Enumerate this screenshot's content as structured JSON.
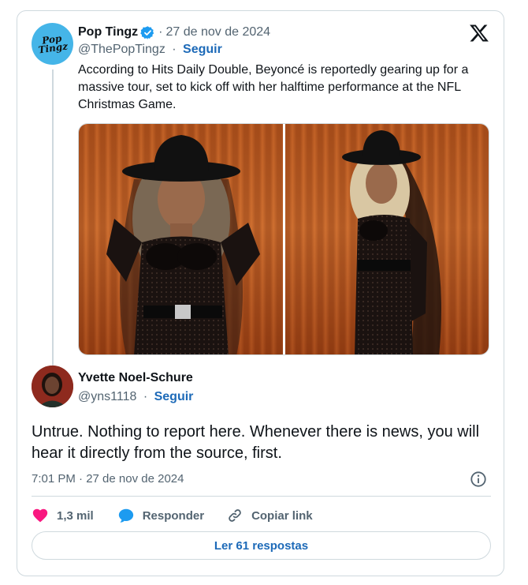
{
  "parent_tweet": {
    "avatar_text": "Pop Tingz",
    "name": "Pop Tingz",
    "separator": "·",
    "date": "27 de nov de 2024",
    "handle": "@ThePopTingz",
    "follow_label": "Seguir",
    "text": "According to Hits Daily Double, Beyoncé is reportedly gearing up for a massive tour, set to kick off with her halftime performance at the NFL Christmas Game.",
    "media_count": 2
  },
  "reply_tweet": {
    "name": "Yvette Noel-Schure",
    "handle": "@yns1118",
    "separator": "·",
    "follow_label": "Seguir",
    "text": "Untrue.  Nothing to report here.  Whenever there is news, you will hear it directly from the source, first.",
    "timestamp": "7:01 PM · 27 de nov de 2024"
  },
  "actions": {
    "like_count": "1,3 mil",
    "reply_label": "Responder",
    "copy_label": "Copiar link",
    "read_replies_label": "Ler 61 respostas"
  },
  "icons": {
    "brand": "x-logo-icon",
    "verified": "verified-badge-icon",
    "like": "heart-icon",
    "reply": "chat-bubble-icon",
    "copy": "link-icon",
    "info": "info-icon"
  },
  "colors": {
    "link_blue": "#1d6ab8",
    "verified_blue": "#1d9bf0",
    "like_pink": "#f91880",
    "muted_text": "#536471",
    "border": "#cfd9de",
    "avatar_blue": "#45b5e8"
  }
}
